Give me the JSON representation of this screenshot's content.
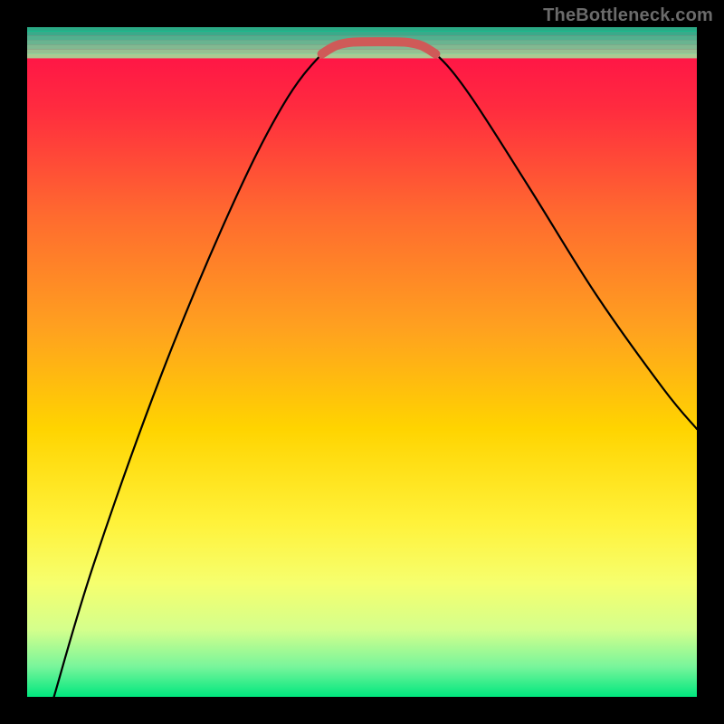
{
  "watermark": "TheBottleneck.com",
  "chart_data": {
    "type": "line",
    "title": "",
    "xlabel": "",
    "ylabel": "",
    "xlim": [
      0,
      100
    ],
    "ylim": [
      0,
      100
    ],
    "grid": false,
    "legend": false,
    "series": [
      {
        "name": "bottleneck-curve",
        "color": "#000000",
        "points": [
          {
            "x": 4,
            "y": 0
          },
          {
            "x": 10,
            "y": 20
          },
          {
            "x": 20,
            "y": 48
          },
          {
            "x": 30,
            "y": 72
          },
          {
            "x": 38,
            "y": 88
          },
          {
            "x": 44,
            "y": 96
          },
          {
            "x": 47,
            "y": 97.5
          },
          {
            "x": 50,
            "y": 97.8
          },
          {
            "x": 55,
            "y": 97.8
          },
          {
            "x": 58,
            "y": 97.5
          },
          {
            "x": 61,
            "y": 96
          },
          {
            "x": 66,
            "y": 90
          },
          {
            "x": 75,
            "y": 76
          },
          {
            "x": 85,
            "y": 60
          },
          {
            "x": 95,
            "y": 46
          },
          {
            "x": 100,
            "y": 40
          }
        ]
      },
      {
        "name": "optimal-range-marker",
        "color": "#cf5a58",
        "points": [
          {
            "x": 44,
            "y": 96
          },
          {
            "x": 46,
            "y": 97.2
          },
          {
            "x": 48,
            "y": 97.7
          },
          {
            "x": 50,
            "y": 97.8
          },
          {
            "x": 55,
            "y": 97.8
          },
          {
            "x": 57,
            "y": 97.7
          },
          {
            "x": 59,
            "y": 97.2
          },
          {
            "x": 61,
            "y": 96
          }
        ]
      }
    ],
    "background_gradient": {
      "stops": [
        {
          "offset": 0.0,
          "color": "#ff0a4a"
        },
        {
          "offset": 0.12,
          "color": "#ff2b3f"
        },
        {
          "offset": 0.28,
          "color": "#ff6a2f"
        },
        {
          "offset": 0.45,
          "color": "#ffa11f"
        },
        {
          "offset": 0.6,
          "color": "#ffd400"
        },
        {
          "offset": 0.74,
          "color": "#fff23a"
        },
        {
          "offset": 0.83,
          "color": "#f6ff6e"
        },
        {
          "offset": 0.9,
          "color": "#d4ff8c"
        },
        {
          "offset": 0.955,
          "color": "#78f59b"
        },
        {
          "offset": 1.0,
          "color": "#00e77e"
        }
      ]
    },
    "green_band": {
      "y_from": 95.5,
      "y_to": 100
    },
    "green_stripes": [
      {
        "y": 95.7,
        "color": "#9fe8a0"
      },
      {
        "y": 96.3,
        "color": "#84dea0"
      },
      {
        "y": 97.0,
        "color": "#6cd79f"
      },
      {
        "y": 97.7,
        "color": "#4fd19e"
      },
      {
        "y": 98.4,
        "color": "#34cc9b"
      },
      {
        "y": 99.1,
        "color": "#18c795"
      },
      {
        "y": 99.7,
        "color": "#06c58f"
      }
    ]
  }
}
